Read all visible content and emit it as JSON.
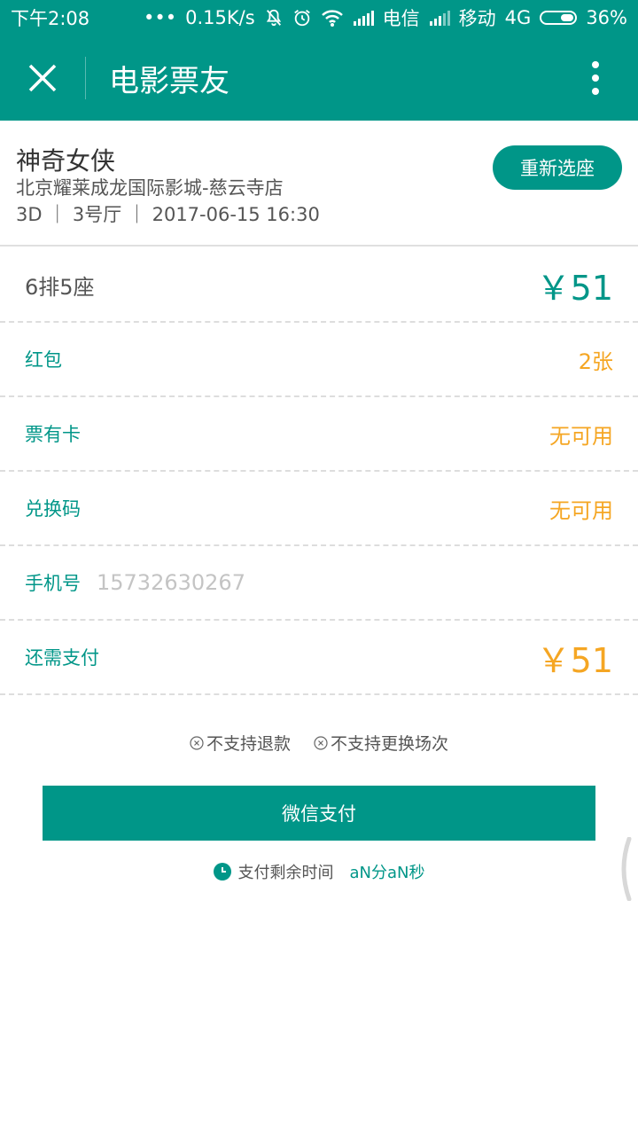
{
  "status_bar": {
    "time": "下午2:08",
    "dots": "•••",
    "speed": "0.15K/s",
    "carrier1": "电信",
    "carrier2": "移动",
    "network": "4G",
    "battery": "36%",
    "icons": [
      "mute-bell-icon",
      "alarm-icon",
      "wifi-icon",
      "signal-icon",
      "signal-icon",
      "battery-icon"
    ]
  },
  "app_bar": {
    "title": "电影票友",
    "close_icon": "close-icon",
    "menu_icon": "more-vertical-icon"
  },
  "movie": {
    "name": "神奇女侠",
    "cinema": "北京耀莱成龙国际影城-慈云寺店",
    "info": "3D ｜ 3号厅 ｜ 2017-06-15 16:30",
    "reselect_label": "重新选座"
  },
  "order": {
    "seat": "6排5座",
    "seat_price": "￥51",
    "red_packet_label": "红包",
    "red_packet_value": "2张",
    "ticket_card_label": "票有卡",
    "ticket_card_value": "无可用",
    "redeem_code_label": "兑换码",
    "redeem_code_value": "无可用",
    "phone_label": "手机号",
    "phone_value": "15732630267",
    "amount_due_label": "还需支付",
    "amount_due_value": "￥51"
  },
  "notices": {
    "no_refund": "不支持退款",
    "no_change": "不支持更换场次"
  },
  "payment": {
    "button_label": "微信支付",
    "timer_label": "支付剩余时间",
    "timer_value": "aN分aN秒"
  },
  "colors": {
    "primary": "#009688",
    "accent": "#f5a623",
    "placeholder": "#c4c4c4"
  }
}
